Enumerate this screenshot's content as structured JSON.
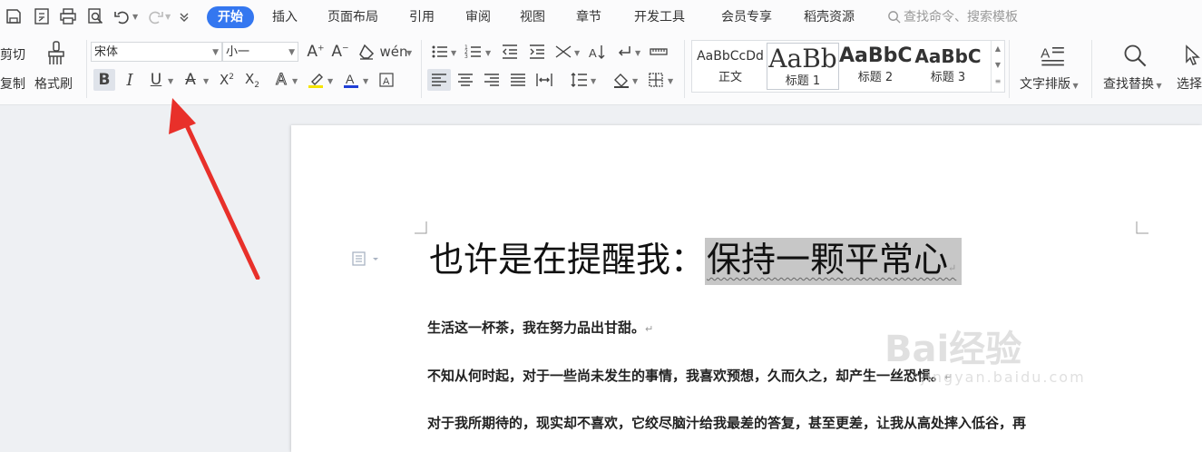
{
  "menu_tabs": [
    "开始",
    "插入",
    "页面布局",
    "引用",
    "审阅",
    "视图",
    "章节",
    "开发工具",
    "会员专享",
    "稻壳资源"
  ],
  "search_placeholder": "查找命令、搜索模板",
  "clipboard": {
    "cut": "剪切",
    "copy": "复制",
    "format_painter": "格式刷"
  },
  "font": {
    "name": "宋体",
    "size": "小一"
  },
  "styles": [
    {
      "sample": "AaBbCcDd",
      "label": "正文"
    },
    {
      "sample": "AaBb",
      "label": "标题 1"
    },
    {
      "sample": "AaBbC",
      "label": "标题 2"
    },
    {
      "sample": "AaBbC",
      "label": "标题 3"
    }
  ],
  "tools": {
    "text_layout": "文字排版",
    "find_replace": "查找替换",
    "select": "选择"
  },
  "document": {
    "title_plain": "也许是在提醒我：",
    "title_highlight": "保持一颗平常心",
    "paragraphs": [
      "生活这一杯茶，我在努力品出甘甜。",
      "不知从何时起，对于一些尚未发生的事情，我喜欢预想，久而久之，却产生一丝恐惧。",
      "对于我所期待的，现实却不喜欢，它绞尽脑汁给我最差的答复，甚至更差，让我从高处摔入低谷，再"
    ]
  },
  "watermark": {
    "brand": "Bai经验",
    "url": "jingyan.baidu.com"
  },
  "colors": {
    "accent": "#3477f0",
    "highlight": "#c7c7c7",
    "arrow": "#e8302a",
    "font_color": "#1f3fd6",
    "highlight_pen": "#f5e400"
  }
}
